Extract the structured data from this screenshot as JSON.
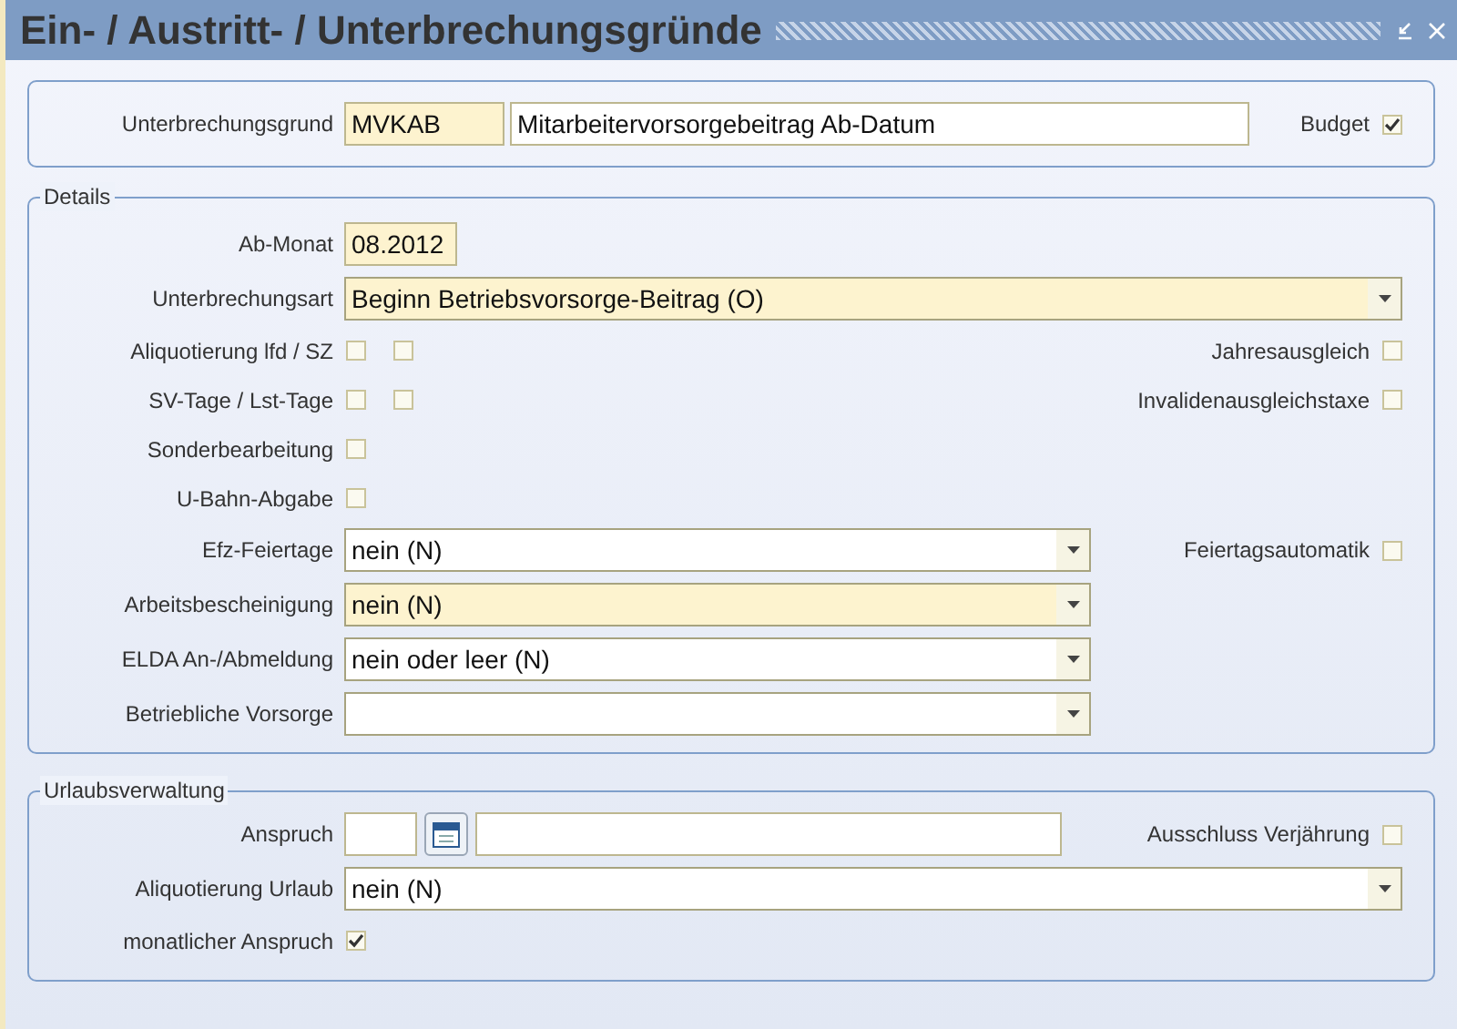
{
  "title": "Ein- / Austritt- / Unterbrechungsgründe",
  "header": {
    "label": "Unterbrechungsgrund",
    "code": "MVKAB",
    "code_required": true,
    "description": "Mitarbeitervorsorgebeitrag Ab-Datum",
    "budget": {
      "label": "Budget",
      "checked": true
    }
  },
  "details": {
    "legend": "Details",
    "rows": [
      {
        "kind": "text",
        "label": "Ab-Monat",
        "value": "08.2012",
        "required": true
      },
      {
        "kind": "select_wide",
        "label": "Unterbrechungsart",
        "value": "Beginn Betriebsvorsorge-Beitrag (O)",
        "required": true
      },
      {
        "kind": "checks",
        "label": "Aliquotierung lfd / SZ",
        "checks": [
          {
            "checked": false
          },
          {
            "checked": false
          }
        ],
        "option": {
          "label": "Jahresausgleich",
          "checked": false
        }
      },
      {
        "kind": "checks",
        "label": "SV-Tage / Lst-Tage",
        "checks": [
          {
            "checked": false
          },
          {
            "checked": false
          }
        ],
        "option": {
          "label": "Invalidenausgleichstaxe",
          "checked": false
        }
      },
      {
        "kind": "checks",
        "label": "Sonderbearbeitung",
        "checks": [
          {
            "checked": false
          }
        ]
      },
      {
        "kind": "checks",
        "label": "U-Bahn-Abgabe",
        "checks": [
          {
            "checked": false
          }
        ]
      },
      {
        "kind": "select",
        "label": "Efz-Feiertage",
        "value": "nein (N)",
        "required": false,
        "option": {
          "label": "Feiertagsautomatik",
          "checked": false
        }
      },
      {
        "kind": "select",
        "label": "Arbeitsbescheinigung",
        "value": "nein (N)",
        "required": true
      },
      {
        "kind": "select",
        "label": "ELDA An-/Abmeldung",
        "value": "nein oder leer (N)",
        "required": false
      },
      {
        "kind": "select",
        "label": "Betriebliche Vorsorge",
        "required": false
      }
    ]
  },
  "vacation": {
    "legend": "Urlaubsverwaltung",
    "rows": [
      {
        "kind": "date",
        "label": "Anspruch",
        "option": {
          "label": "Ausschluss Verjährung",
          "checked": false
        }
      },
      {
        "kind": "select_wide",
        "label": "Aliquotierung Urlaub",
        "value": "nein (N)",
        "required": false
      },
      {
        "kind": "checks",
        "label": "monatlicher Anspruch",
        "checks": [
          {
            "checked": true
          }
        ]
      }
    ]
  }
}
